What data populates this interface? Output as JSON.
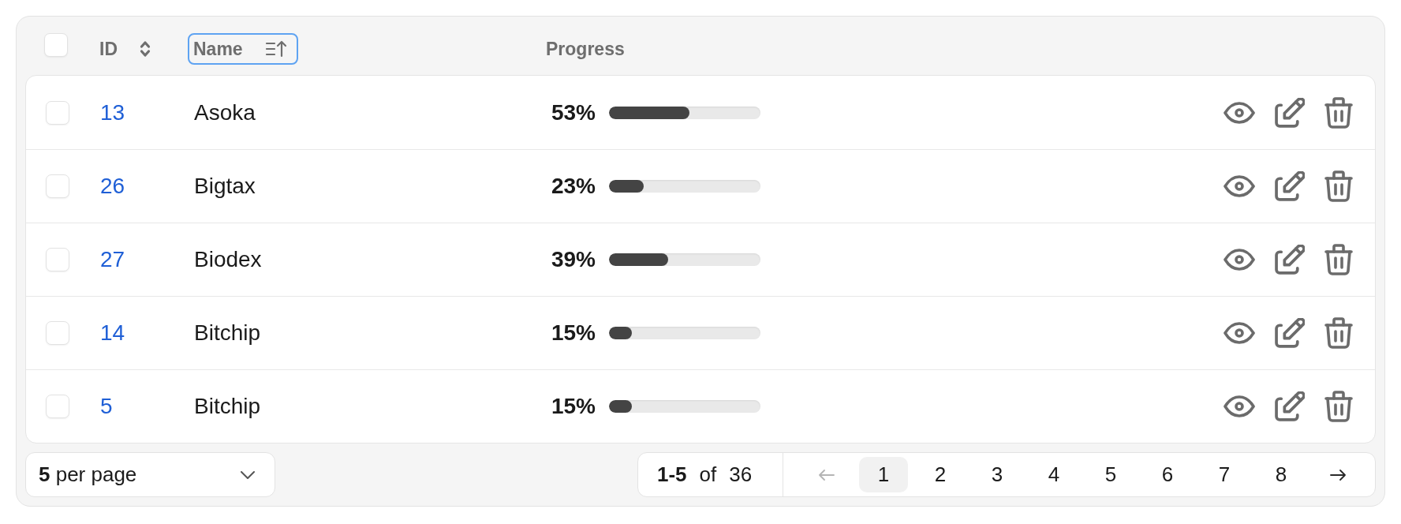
{
  "table": {
    "select_all": {
      "checked": false
    },
    "columns": [
      {
        "label": "ID",
        "sorted": false,
        "focused": false
      },
      {
        "label": "Name",
        "sorted": true,
        "descending": false,
        "focused": true
      },
      {
        "label": "Progress"
      }
    ],
    "rows": [
      {
        "checked": false,
        "id": "13",
        "name": "Asoka",
        "progress": "53%",
        "level": 0.53
      },
      {
        "checked": false,
        "id": "26",
        "name": "Bigtax",
        "progress": "23%",
        "level": 0.23
      },
      {
        "checked": false,
        "id": "27",
        "name": "Biodex",
        "progress": "39%",
        "level": 0.39
      },
      {
        "checked": false,
        "id": "14",
        "name": "Bitchip",
        "progress": "15%",
        "level": 0.15
      },
      {
        "checked": false,
        "id": "5",
        "name": "Bitchip",
        "progress": "15%",
        "level": 0.15
      }
    ]
  },
  "footer": {
    "per_page": "**5** per page",
    "range": "1-5",
    "of": "of",
    "total": "36",
    "prev": {
      "disabled": true
    },
    "pages": [
      {
        "label": "1",
        "selected": true
      },
      {
        "label": "2",
        "selected": false
      },
      {
        "label": "3",
        "selected": false
      },
      {
        "label": "4",
        "selected": false
      },
      {
        "label": "5",
        "selected": false
      },
      {
        "label": "6",
        "selected": false
      },
      {
        "label": "7",
        "selected": false
      },
      {
        "label": "8",
        "selected": false
      }
    ],
    "next": {
      "disabled": false
    }
  }
}
